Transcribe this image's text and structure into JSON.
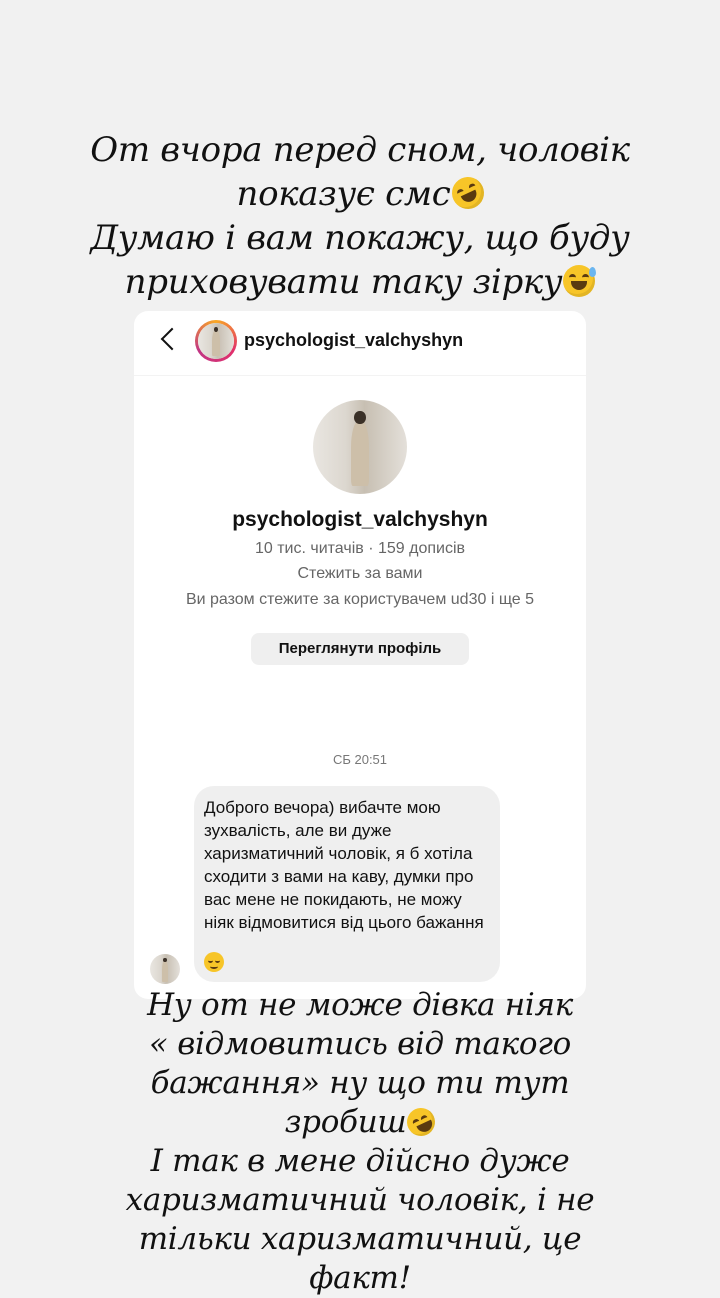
{
  "story": {
    "caption_top": [
      "От вчора перед сном, чоловік",
      "показує смс",
      "Думаю і вам покажу, що буду",
      "приховувати таку зірку"
    ],
    "caption_bottom": [
      "Ну от не може дівка ніяк",
      "« відмовитись від такого",
      "бажання» ну що ти тут",
      "зробиш",
      "І так в мене дійсно дуже",
      "харизматичний чоловік, і не",
      "тільки харизматичний, це",
      "факт!"
    ],
    "emojis": [
      "rolling-on-floor-laughing",
      "grinning-sweat",
      "rolling-on-floor-laughing"
    ]
  },
  "dm": {
    "header_username": "psychologist_valchyshyn",
    "profile": {
      "name": "psychologist_valchyshyn",
      "stats": "10 тис. читачів · 159 дописів",
      "follows": "Стежить за вами",
      "mutual": "Ви разом стежите за користувачем ud30 і ще 5",
      "view_profile_label": "Переглянути профіль"
    },
    "timestamp": "СБ 20:51",
    "message": {
      "text": "Доброго вечора) вибачте мою зухвалість, але ви дуже харизматичний чоловік, я б хотіла сходити з вами на каву, думки про вас мене не покидають, не можу ніяк відмовитися від цього бажання",
      "emoji": "smiling-face"
    }
  }
}
